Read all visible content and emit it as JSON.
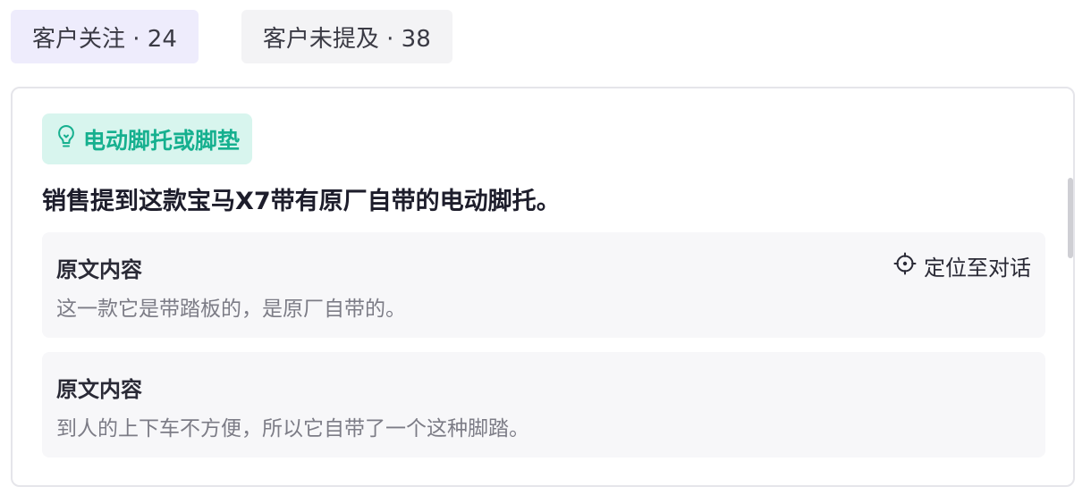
{
  "tabs": [
    {
      "label": "客户关注 · 24"
    },
    {
      "label": "客户未提及 · 38"
    }
  ],
  "card": {
    "tag": {
      "label": "电动脚托或脚垫",
      "icon": "lightbulb-icon",
      "color": "#16b08f"
    },
    "summary": "销售提到这款宝马X7带有原厂自带的电动脚托。",
    "locate_label": "定位至对话",
    "quotes": [
      {
        "title": "原文内容",
        "text": "这一款它是带踏板的，是原厂自带的。"
      },
      {
        "title": "原文内容",
        "text": "到人的上下车不方便，所以它自带了一个这种脚踏。"
      }
    ]
  }
}
